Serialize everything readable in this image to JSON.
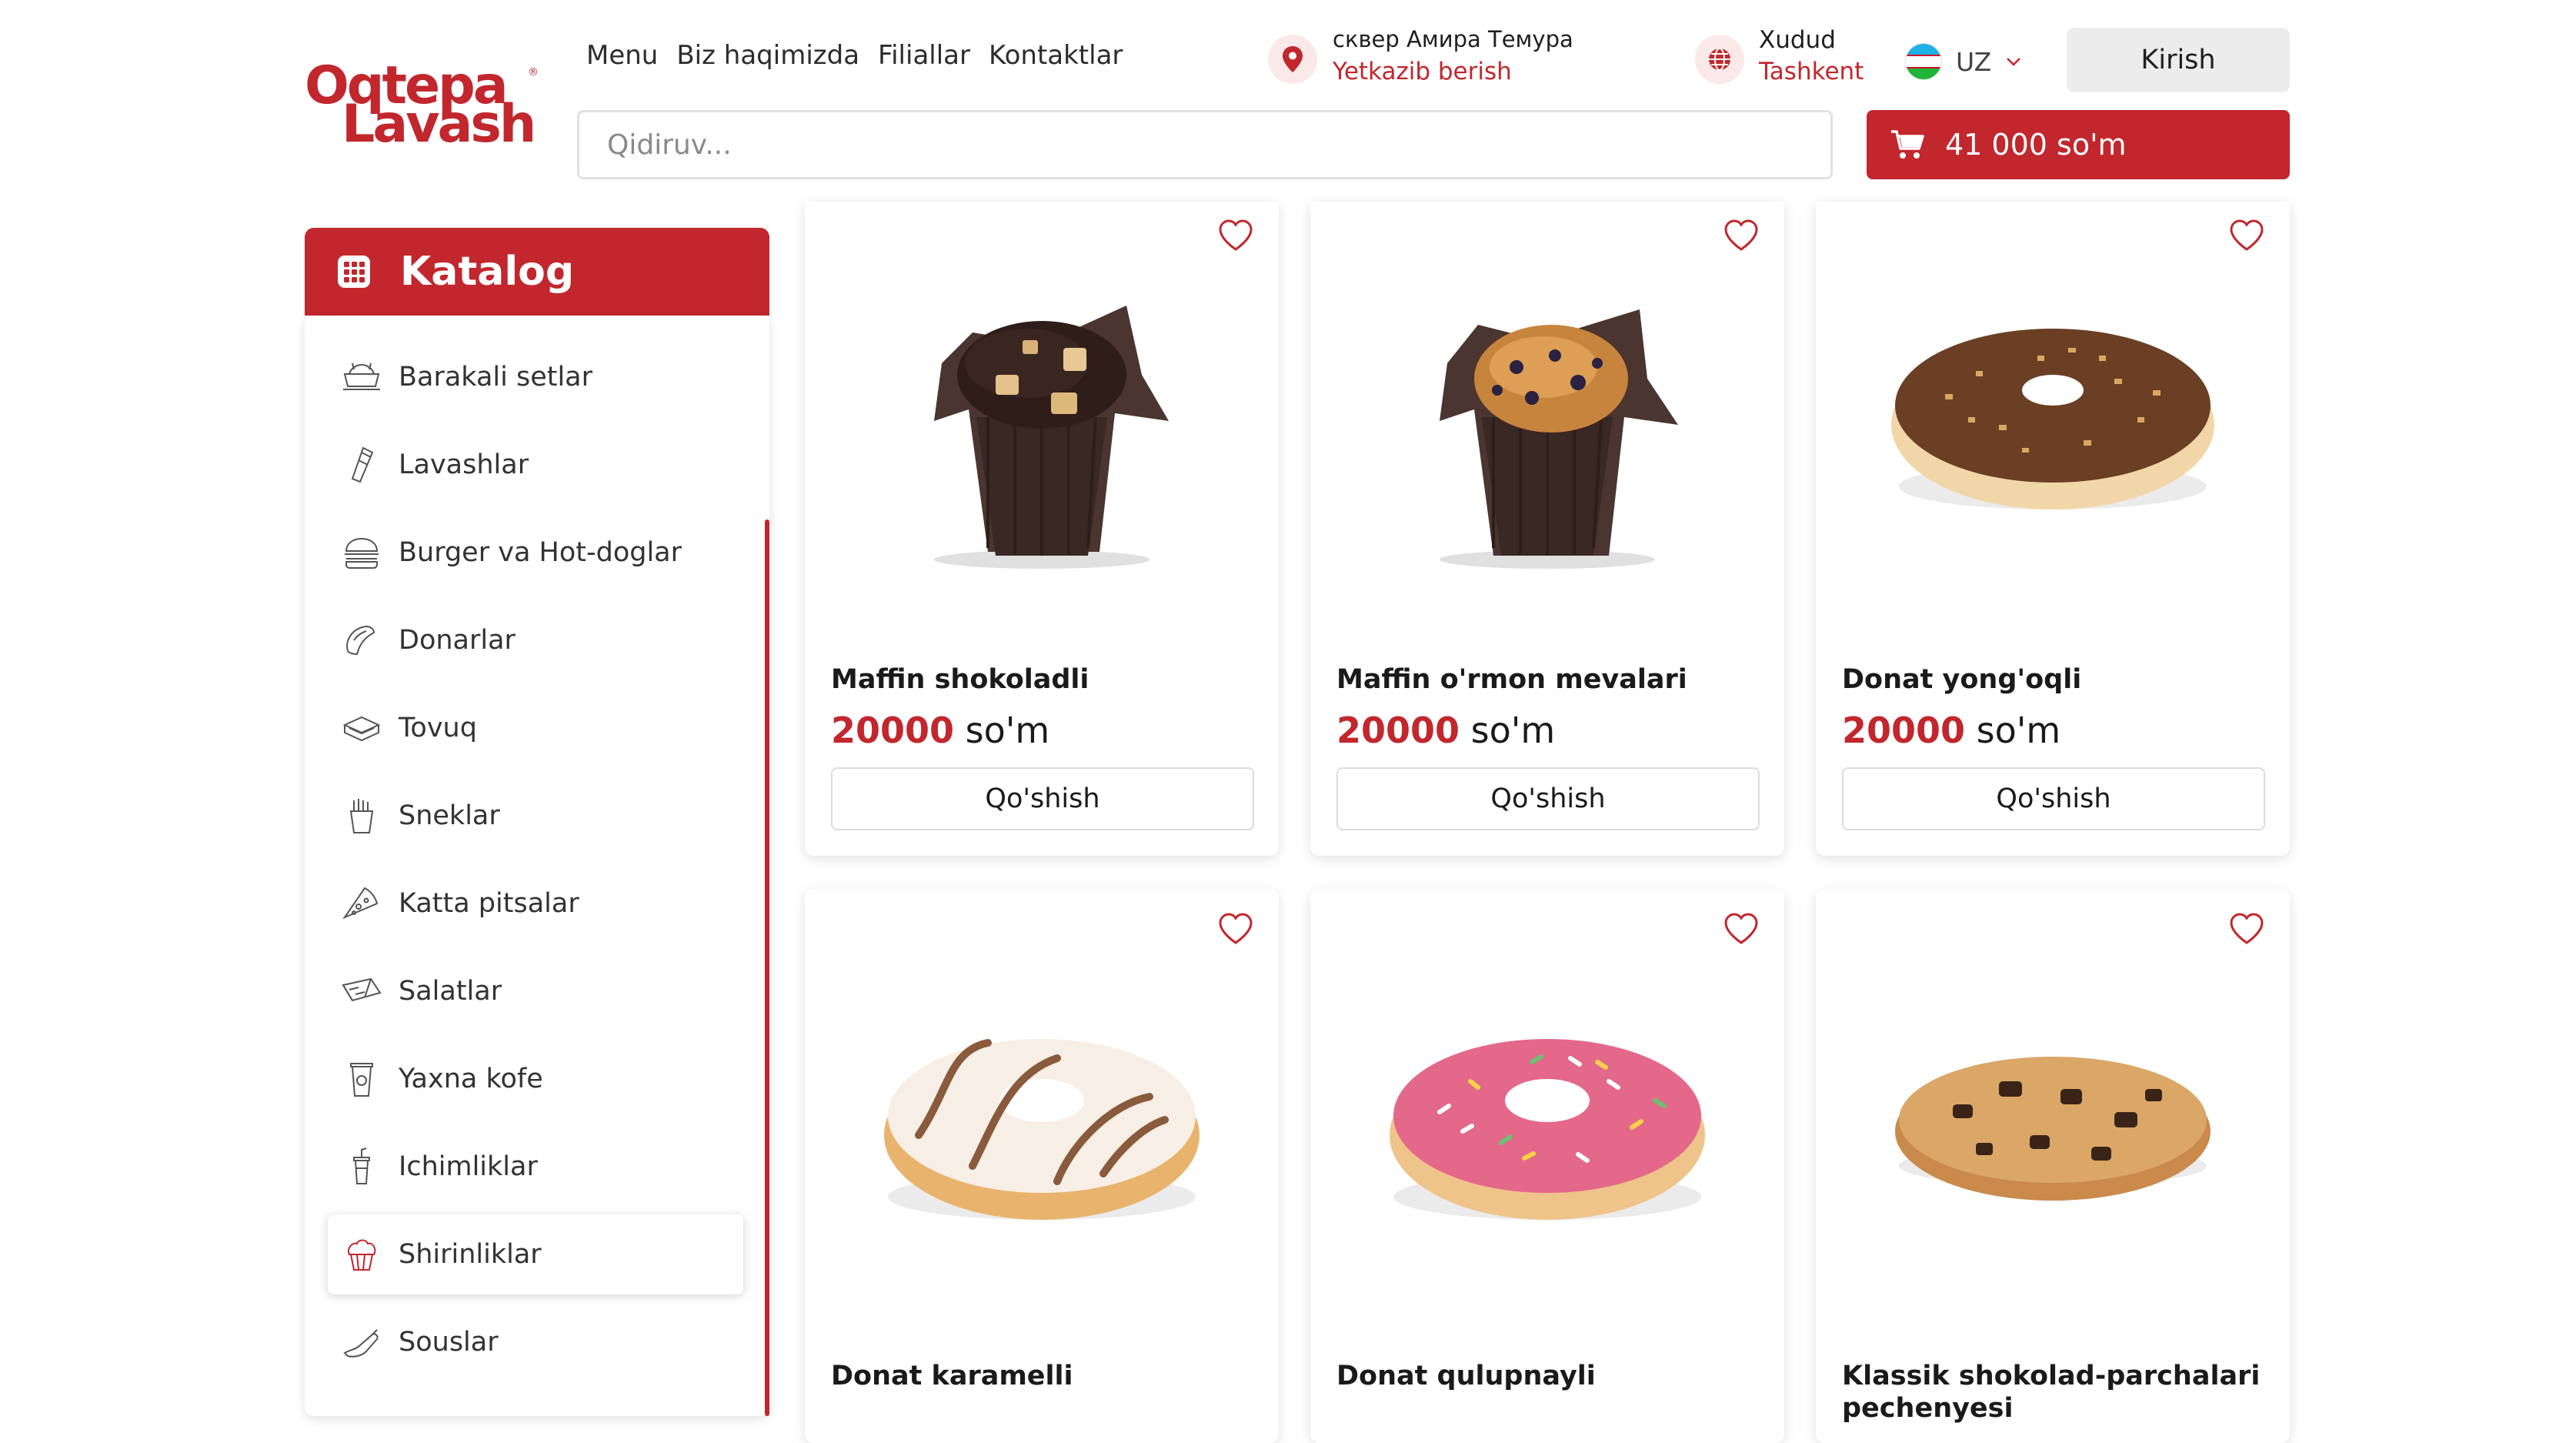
{
  "brand": {
    "line1": "Oqtepa",
    "line2": "Lavash",
    "reg": "®"
  },
  "nav": [
    "Menu",
    "Biz haqimizda",
    "Filiallar",
    "Kontaktlar"
  ],
  "location": {
    "address": "сквер Амира Темура",
    "mode": "Yetkazib berish"
  },
  "region": {
    "title": "Xudud",
    "city": "Tashkent"
  },
  "language": {
    "code": "UZ"
  },
  "login_label": "Kirish",
  "search": {
    "placeholder": "Qidiruv..."
  },
  "cart": {
    "total": "41 000 so'm"
  },
  "catalog": {
    "title": "Katalog",
    "items": [
      {
        "label": "Barakali setlar",
        "icon": "combo-set-icon"
      },
      {
        "label": "Lavashlar",
        "icon": "lavash-icon"
      },
      {
        "label": "Burger va Hot-doglar",
        "icon": "burger-icon"
      },
      {
        "label": "Donarlar",
        "icon": "doner-icon"
      },
      {
        "label": "Tovuq",
        "icon": "chicken-icon"
      },
      {
        "label": "Sneklar",
        "icon": "fries-icon"
      },
      {
        "label": "Katta pitsalar",
        "icon": "pizza-icon"
      },
      {
        "label": "Salatlar",
        "icon": "salad-icon"
      },
      {
        "label": "Yaxna kofe",
        "icon": "iced-coffee-icon"
      },
      {
        "label": "Ichimliklar",
        "icon": "drink-icon"
      },
      {
        "label": "Shirinliklar",
        "icon": "cupcake-icon",
        "active": true
      },
      {
        "label": "Souslar",
        "icon": "sauce-icon"
      }
    ]
  },
  "products": [
    {
      "name": "Maffin shokoladli",
      "price": "20000",
      "currency": "so'm",
      "add_label": "Qo'shish",
      "image": "chocolate-muffin"
    },
    {
      "name": "Maffin o'rmon mevalari",
      "price": "20000",
      "currency": "so'm",
      "add_label": "Qo'shish",
      "image": "berry-muffin"
    },
    {
      "name": "Donat yong'oqli",
      "price": "20000",
      "currency": "so'm",
      "add_label": "Qo'shish",
      "image": "nut-donut"
    },
    {
      "name": "Donat karamelli",
      "image": "caramel-donut"
    },
    {
      "name": "Donat qulupnayli",
      "image": "strawberry-donut"
    },
    {
      "name": "Klassik shokolad-parchalari pechenyesi",
      "image": "chocolate-chip-cookie"
    }
  ],
  "colors": {
    "accent": "#c1272d",
    "accent_soft": "#fbe9e9",
    "button_grey": "#ececec"
  }
}
